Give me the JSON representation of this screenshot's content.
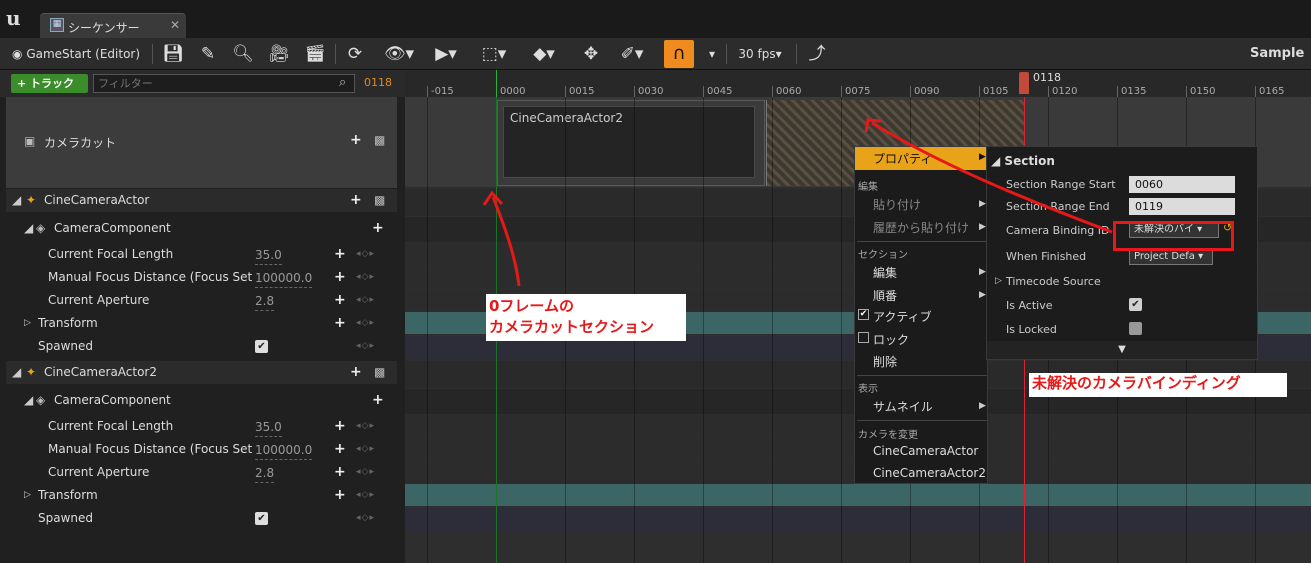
{
  "window": {
    "tab_label": "シーケンサー",
    "close": "✕",
    "logo": "u"
  },
  "toolbar": {
    "world": "GameStart (Editor)",
    "fps": "30 fps",
    "sequence": "Sample"
  },
  "tracks": {
    "add_track": "+ トラック",
    "filter_placeholder": "フィルター",
    "current_frame": "0118",
    "camera_cuts": "カメラカット"
  },
  "actor1": {
    "name": "CineCameraActor",
    "component": "CameraComponent",
    "props": [
      {
        "label": "Current Focal Length",
        "value": "35.0"
      },
      {
        "label": "Manual Focus Distance (Focus Settin",
        "value": "100000.0"
      },
      {
        "label": "Current Aperture",
        "value": "2.8"
      }
    ],
    "transform": "Transform",
    "spawned": "Spawned"
  },
  "actor2": {
    "name": "CineCameraActor2",
    "component": "CameraComponent",
    "props": [
      {
        "label": "Current Focal Length",
        "value": "35.0"
      },
      {
        "label": "Manual Focus Distance (Focus Settin",
        "value": "100000.0"
      },
      {
        "label": "Current Aperture",
        "value": "2.8"
      }
    ],
    "transform": "Transform",
    "spawned": "Spawned"
  },
  "ruler": {
    "ticks": [
      "-015",
      "0000",
      "0015",
      "0030",
      "0045",
      "0060",
      "0075",
      "0090",
      "0105",
      "0120",
      "0135",
      "0150",
      "0165"
    ],
    "playhead": "0118"
  },
  "section": {
    "label": "CineCameraActor2"
  },
  "context_menu": {
    "properties": "プロパティ",
    "edit_header": "編集",
    "paste": "貼り付け",
    "paste_history": "履歴から貼り付け",
    "section_header": "セクション",
    "edit": "編集",
    "order": "順番",
    "active": "アクティブ",
    "lock": "ロック",
    "delete": "削除",
    "display_header": "表示",
    "thumbnail": "サムネイル",
    "change_camera_header": "カメラを変更",
    "camera1": "CineCameraActor",
    "camera2": "CineCameraActor2"
  },
  "details": {
    "title": "Section",
    "range_start_label": "Section Range Start",
    "range_start": "0060",
    "range_end_label": "Section Range End",
    "range_end": "0119",
    "binding_label": "Camera Binding ID",
    "binding_value": "未解決のバイ",
    "when_finished_label": "When Finished",
    "when_finished": "Project Defa",
    "timecode_label": "Timecode Source",
    "is_active_label": "Is Active",
    "is_locked_label": "Is Locked"
  },
  "annotations": {
    "frame0_line1": "0フレームの",
    "frame0_line2": "カメラカットセクション",
    "unresolved": "未解決のカメラバインディング"
  },
  "colors": {
    "accent": "#f08b1e",
    "annotation": "#e81818",
    "add_track": "#3b8c2a"
  }
}
